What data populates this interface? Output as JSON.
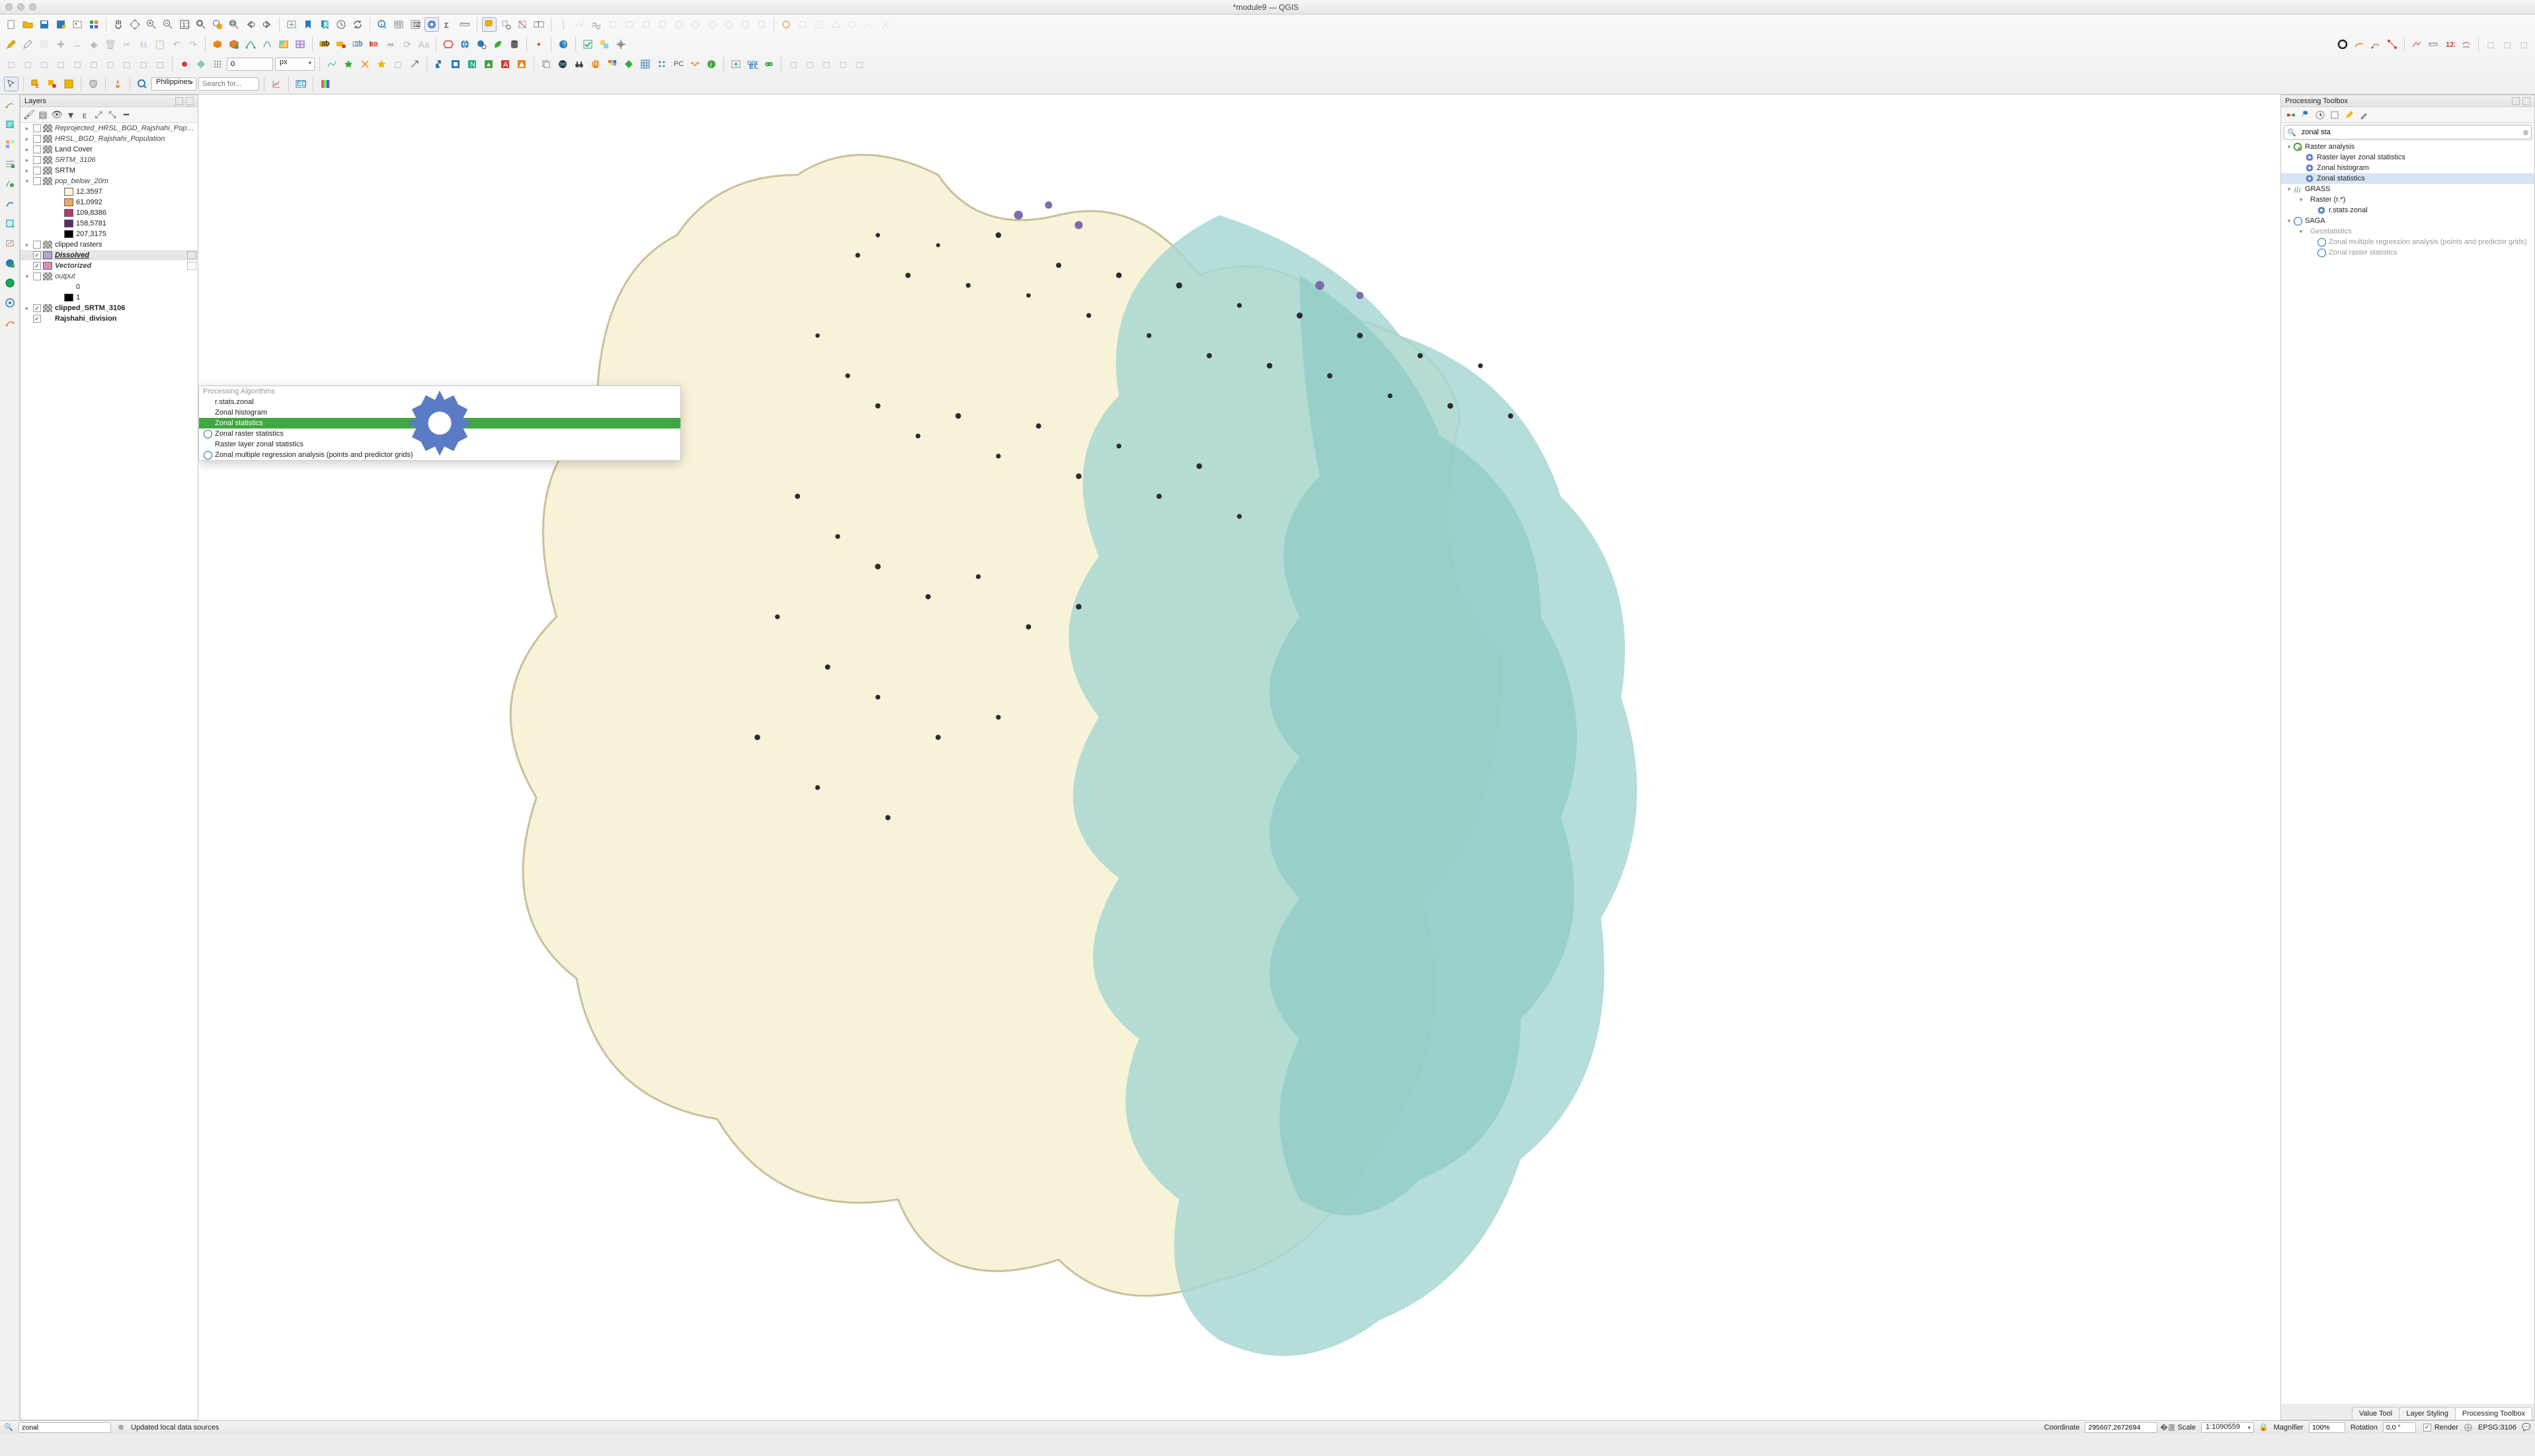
{
  "window": {
    "title": "*module9 — QGIS"
  },
  "toolbar4": {
    "locator_label": "Philippines",
    "locator_placeholder": "Search for...",
    "spin_value": "0",
    "spin_unit": "px"
  },
  "layers_panel": {
    "title": "Layers",
    "items": [
      {
        "indent": 0,
        "expand": "▸",
        "checked": false,
        "symtype": "raster",
        "name": "Reprojected_HRSL_BGD_Rajshahi_Population",
        "italic": true
      },
      {
        "indent": 0,
        "expand": "▸",
        "checked": false,
        "symtype": "raster",
        "name": "HRSL_BGD_Rajshahi_Population",
        "italic": true
      },
      {
        "indent": 0,
        "expand": "▸",
        "checked": false,
        "symtype": "raster",
        "name": "Land Cover"
      },
      {
        "indent": 0,
        "expand": "▸",
        "checked": false,
        "symtype": "raster",
        "name": "SRTM_3106",
        "italic": true
      },
      {
        "indent": 0,
        "expand": "▸",
        "checked": false,
        "symtype": "raster",
        "name": "SRTM"
      },
      {
        "indent": 0,
        "expand": "▾",
        "checked": false,
        "symtype": "raster",
        "name": "pop_below_20m",
        "italic": true
      },
      {
        "indent": 2,
        "symtype": "fill",
        "color": "#faf6c9",
        "name": "12,3597"
      },
      {
        "indent": 2,
        "symtype": "fill",
        "color": "#f0a65c",
        "name": "61,0992"
      },
      {
        "indent": 2,
        "symtype": "fill",
        "color": "#b33a6e",
        "name": "109,8386"
      },
      {
        "indent": 2,
        "symtype": "fill",
        "color": "#5c2a6e",
        "name": "158,5781"
      },
      {
        "indent": 2,
        "symtype": "fill",
        "color": "#000000",
        "name": "207,3175"
      },
      {
        "indent": 0,
        "expand": "▸",
        "checked": false,
        "symtype": "raster",
        "name": "clipped rasters"
      },
      {
        "indent": 0,
        "expand": "",
        "checked": true,
        "symtype": "fill",
        "color": "#b3a3d1",
        "name": "Dissolved",
        "bolditalic": true,
        "sel": true,
        "indicator": true
      },
      {
        "indent": 0,
        "expand": "",
        "checked": true,
        "symtype": "fill",
        "color": "#d98fb6",
        "name": "Vectorized",
        "bold": true,
        "italic": true,
        "indicator": true
      },
      {
        "indent": 0,
        "expand": "▾",
        "checked": false,
        "symtype": "raster",
        "name": "output",
        "italic": true
      },
      {
        "indent": 2,
        "symtype": "none",
        "name": "0"
      },
      {
        "indent": 2,
        "symtype": "fill",
        "color": "#000000",
        "name": "1"
      },
      {
        "indent": 0,
        "expand": "▸",
        "checked": true,
        "symtype": "raster",
        "name": "clipped_SRTM_3106",
        "bold": true
      },
      {
        "indent": 0,
        "expand": "",
        "checked": true,
        "symtype": "none",
        "name": "Rajshahi_division",
        "bold": true
      }
    ]
  },
  "algo_dropdown": {
    "header": "Processing Algorithms",
    "items": [
      {
        "icon": "gear",
        "label": "r.stats.zonal"
      },
      {
        "icon": "gear",
        "label": "Zonal histogram"
      },
      {
        "icon": "gear",
        "label": "Zonal statistics",
        "selected": true
      },
      {
        "icon": "saga",
        "label": "Zonal raster statistics"
      },
      {
        "icon": "gear",
        "label": "Raster layer zonal statistics"
      },
      {
        "icon": "saga",
        "label": "Zonal multiple regression analysis (points and predictor grids)"
      }
    ]
  },
  "processing_panel": {
    "title": "Processing Toolbox",
    "search_value": "zonal sta",
    "tree": [
      {
        "indent": 0,
        "expand": "▾",
        "icon": "qgis",
        "label": "Raster analysis"
      },
      {
        "indent": 1,
        "icon": "gear",
        "label": "Raster layer zonal statistics"
      },
      {
        "indent": 1,
        "icon": "gear",
        "label": "Zonal histogram"
      },
      {
        "indent": 1,
        "icon": "gear",
        "label": "Zonal statistics",
        "sel": true
      },
      {
        "indent": 0,
        "expand": "▾",
        "icon": "grass",
        "label": "GRASS"
      },
      {
        "indent": 1,
        "expand": "▾",
        "label": "Raster (r.*)"
      },
      {
        "indent": 2,
        "icon": "gear",
        "label": "r.stats.zonal"
      },
      {
        "indent": 0,
        "expand": "▾",
        "icon": "saga",
        "label": "SAGA"
      },
      {
        "indent": 1,
        "expand": "▾",
        "label": "Geostatistics",
        "grey": true
      },
      {
        "indent": 2,
        "icon": "saga",
        "label": "Zonal multiple regression analysis (points and predictor grids)",
        "grey": true
      },
      {
        "indent": 2,
        "icon": "saga",
        "label": "Zonal raster statistics",
        "grey": true
      }
    ]
  },
  "bottom_tabs": [
    "Value Tool",
    "Layer Styling",
    "Processing Toolbox"
  ],
  "bottom_tabs_active": 2,
  "statusbar": {
    "locator_value": "zonal",
    "message": "Updated local data sources",
    "coord_label": "Coordinate",
    "coord_value": "295607,2672694",
    "scale_label": "Scale",
    "scale_value": "1:1090559",
    "magnifier_label": "Magnifier",
    "magnifier_value": "100%",
    "rotation_label": "Rotation",
    "rotation_value": "0,0 °",
    "render_label": "Render",
    "crs_label": "EPSG:3106"
  }
}
